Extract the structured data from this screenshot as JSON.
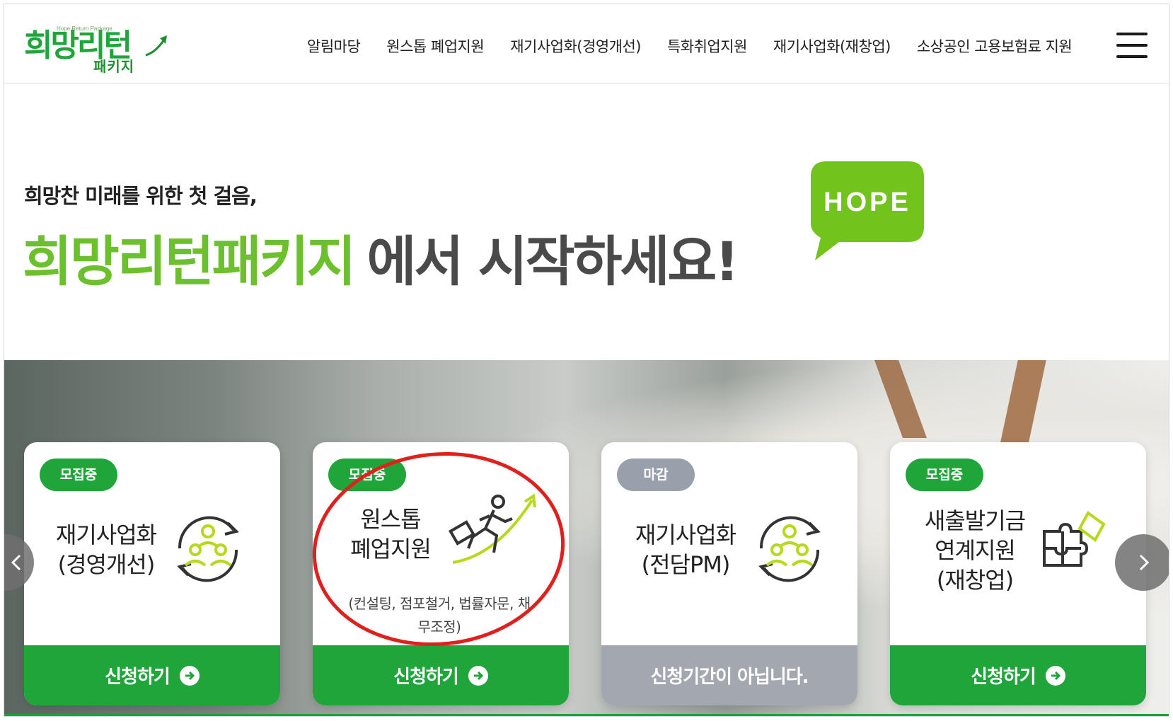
{
  "logo": {
    "main": "희망리턴",
    "tag": "Hope Return Package",
    "sub": "패키지"
  },
  "nav": {
    "items": [
      {
        "label": "알림마당"
      },
      {
        "label": "원스톱 폐업지원"
      },
      {
        "label": "재기사업화(경영개선)"
      },
      {
        "label": "특화취업지원"
      },
      {
        "label": "재기사업화(재창업)"
      },
      {
        "label": "소상공인 고용보험료 지원"
      }
    ]
  },
  "hero": {
    "subtitle": "희망찬 미래를 위한 첫 걸음,",
    "title_green": "희망리턴패키지",
    "title_dark": "에서 시작하세요!",
    "badge_text": "HOPE"
  },
  "cards": [
    {
      "status": "모집중",
      "title_line1": "재기사업화",
      "title_line2": "(경영개선)",
      "button": "신청하기",
      "icon": "people-cycle-icon"
    },
    {
      "status": "모집중",
      "title_line1": "원스톱",
      "title_line2": "폐업지원",
      "desc_line1": "(컨설팅, 점포철거, 법률자문, 채",
      "desc_line2": "무조정)",
      "button": "신청하기",
      "icon": "running-businessman-icon"
    },
    {
      "status": "마감",
      "title_line1": "재기사업화",
      "title_line2": "(전담PM)",
      "button": "신청기간이 아닙니다.",
      "icon": "people-cycle-icon"
    },
    {
      "status": "모집중",
      "title_line1": "새출발기금",
      "title_line2": "연계지원",
      "title_line3": "(재창업)",
      "button": "신청하기",
      "icon": "puzzle-icon"
    }
  ],
  "colors": {
    "brand_green": "#20a53a",
    "hero_green": "#6cbf2d",
    "closed_gray": "#a3a8b0",
    "annotation_red": "#e0201c"
  }
}
